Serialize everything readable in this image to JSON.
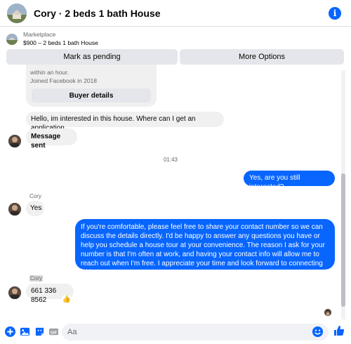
{
  "header": {
    "title": "Cory · 2 beds 1 bath House",
    "info_icon": "info-icon"
  },
  "marketplace": {
    "label": "Marketplace",
    "listing": "$900 – 2 beds 1 bath House",
    "mark_pending": "Mark as pending",
    "more_options": "More Options"
  },
  "card": {
    "line1": "within an hour.",
    "line2": "Joined Facebook in 2018",
    "buyer_details": "Buyer details"
  },
  "messages": {
    "m1": "Hello, im interested in this house. Where can I get an application",
    "m2": "Message sent",
    "time": "01:43",
    "m3": "Yes, are you still interested?",
    "sender1": "Cory",
    "m4": "Yes",
    "m5": "If you're comfortable, please feel free to share your contact number so we can discuss the details directly. I'd be happy to answer any questions you have or help you schedule a house tour at your convenience. The reason I ask for your number is that I'm often at work, and having your contact info will allow me to reach out when I'm free. I appreciate your time and look forward to connecting with you soon!",
    "sender2": "Cory",
    "m6": "661 336 8562",
    "reaction": "👍"
  },
  "composer": {
    "placeholder": "Aa"
  },
  "colors": {
    "accent": "#0866ff",
    "bubble_in": "#f0f0f0",
    "button_gray": "#e4e6eb"
  }
}
